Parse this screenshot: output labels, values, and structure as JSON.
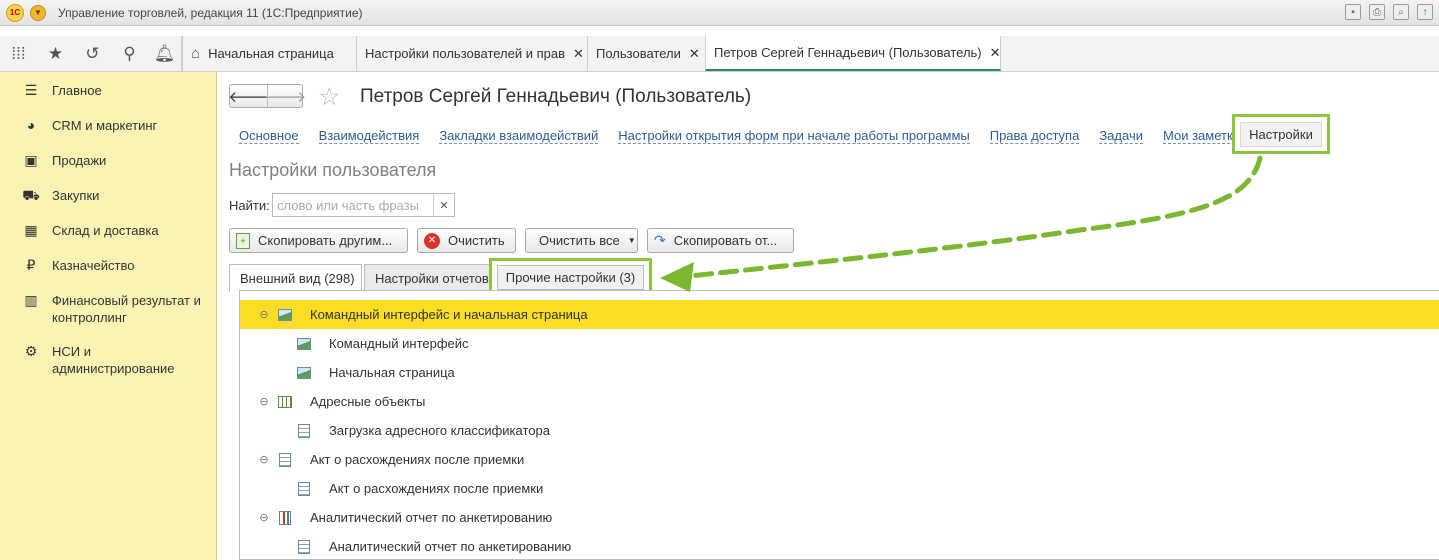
{
  "window": {
    "app_title": "Управление торговлей, редакция 11  (1С:Предприятие)",
    "logo_text": "1С"
  },
  "topbar": {
    "tabs": [
      {
        "label": "Начальная страница",
        "closable": false
      },
      {
        "label": "Настройки пользователей и прав",
        "closable": true
      },
      {
        "label": "Пользователи",
        "closable": true
      },
      {
        "label": "Петров Сергей Геннадьевич (Пользователь)",
        "closable": true,
        "active": true
      }
    ],
    "close_glyph": "✕"
  },
  "sidebar": {
    "items": [
      {
        "label": "Главное",
        "icon": "menu-icon"
      },
      {
        "label": "CRM и маркетинг",
        "icon": "pie-chart-icon"
      },
      {
        "label": "Продажи",
        "icon": "bag-icon"
      },
      {
        "label": "Закупки",
        "icon": "cart-icon"
      },
      {
        "label": "Склад и доставка",
        "icon": "warehouse-icon"
      },
      {
        "label": "Казначейство",
        "icon": "ruble-icon"
      },
      {
        "label": "Финансовый результат и контроллинг",
        "icon": "bar-chart-icon"
      },
      {
        "label": "НСИ и администрирование",
        "icon": "gear-icon"
      }
    ]
  },
  "form": {
    "title": "Петров Сергей Геннадьевич (Пользователь)",
    "links": [
      "Основное",
      "Взаимодействия",
      "Закладки взаимодействий",
      "Настройки открытия форм при начале работы программы",
      "Права доступа",
      "Задачи",
      "Мои заметки"
    ],
    "active_link": "Настройки",
    "section_title": "Настройки пользователя",
    "find_label": "Найти:",
    "find_placeholder": "слово или часть фразы",
    "buttons": {
      "copy_to_others": "Скопировать другим...",
      "clear": "Очистить",
      "clear_all": "Очистить все",
      "copy_from": "Скопировать от..."
    },
    "sub_tabs": [
      "Внешний вид (298)",
      "Настройки отчетов",
      "Прочие настройки (3)"
    ],
    "tree": [
      {
        "label": "Командный интерфейс и начальная страница",
        "level": 0,
        "icon": "picture-icon",
        "expanded": true,
        "selected": true
      },
      {
        "label": "Командный интерфейс",
        "level": 1,
        "icon": "picture-icon"
      },
      {
        "label": "Начальная страница",
        "level": 1,
        "icon": "picture-icon"
      },
      {
        "label": "Адресные объекты",
        "level": 0,
        "icon": "table-icon",
        "expanded": true
      },
      {
        "label": "Загрузка адресного классификатора",
        "level": 1,
        "icon": "document-icon"
      },
      {
        "label": "Акт о расхождениях после приемки",
        "level": 0,
        "icon": "document-icon",
        "expanded": true
      },
      {
        "label": "Акт о расхождениях после приемки",
        "level": 1,
        "icon": "document-icon"
      },
      {
        "label": "Аналитический отчет по анкетированию",
        "level": 0,
        "icon": "report-icon",
        "expanded": true
      },
      {
        "label": "Аналитический отчет по анкетированию",
        "level": 1,
        "icon": "document-icon"
      }
    ]
  },
  "colors": {
    "sidebar_bg": "#fbf3b3",
    "selected_row": "#f9de25",
    "highlight_green": "#8cc63f",
    "link_blue": "#2f5c99"
  }
}
